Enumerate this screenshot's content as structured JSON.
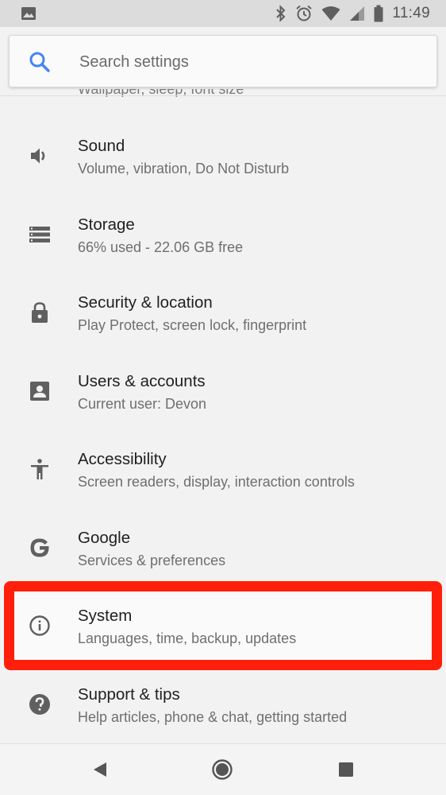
{
  "status_bar": {
    "time": "11:49",
    "icons": [
      "image-icon",
      "bluetooth-icon",
      "alarm-icon",
      "wifi-icon",
      "cellular-icon",
      "battery-icon"
    ]
  },
  "search": {
    "placeholder": "Search settings"
  },
  "cutoff_item": {
    "subtitle_fragment": "Wallpaper, sleep, font size"
  },
  "settings": [
    {
      "icon": "volume-icon",
      "title": "Sound",
      "subtitle": "Volume, vibration, Do Not Disturb"
    },
    {
      "icon": "storage-icon",
      "title": "Storage",
      "subtitle": "66% used - 22.06 GB free"
    },
    {
      "icon": "lock-icon",
      "title": "Security & location",
      "subtitle": "Play Protect, screen lock, fingerprint"
    },
    {
      "icon": "account-box-icon",
      "title": "Users & accounts",
      "subtitle": "Current user: Devon"
    },
    {
      "icon": "accessibility-icon",
      "title": "Accessibility",
      "subtitle": "Screen readers, display, interaction controls"
    },
    {
      "icon": "google-icon",
      "title": "Google",
      "subtitle": "Services & preferences"
    },
    {
      "icon": "info-icon",
      "title": "System",
      "subtitle": "Languages, time, backup, updates"
    },
    {
      "icon": "help-icon",
      "title": "Support & tips",
      "subtitle": "Help articles, phone & chat, getting started"
    }
  ],
  "highlight_color": "#ff1f0a",
  "nav_bar": {
    "buttons": [
      "back-icon",
      "home-icon",
      "recents-icon"
    ]
  }
}
